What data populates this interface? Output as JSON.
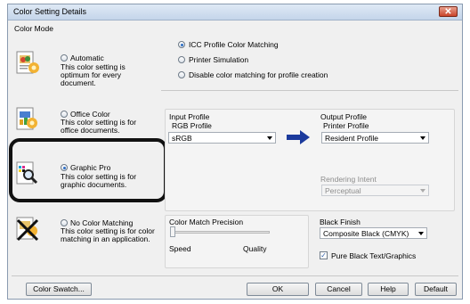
{
  "window": {
    "title": "Color Setting Details",
    "close_glyph": "✕"
  },
  "color_mode": {
    "label": "Color Mode",
    "modes": [
      {
        "label": "Automatic",
        "desc": "This color setting is optimum for every document.",
        "selected": false,
        "icon": "automatic-color-icon"
      },
      {
        "label": "Office Color",
        "desc": "This color setting is for office documents.",
        "selected": false,
        "icon": "office-color-icon"
      },
      {
        "label": "Graphic Pro",
        "desc": "This color setting is for graphic documents.",
        "selected": true,
        "icon": "graphic-pro-icon"
      },
      {
        "label": "No Color Matching",
        "desc": "This color setting is for color matching in an application.",
        "selected": false,
        "icon": "no-color-matching-icon"
      }
    ]
  },
  "matching_options": [
    {
      "label": "ICC Profile Color Matching",
      "selected": true
    },
    {
      "label": "Printer Simulation",
      "selected": false
    },
    {
      "label": "Disable color matching for profile creation",
      "selected": false
    }
  ],
  "input_profile": {
    "label": "Input Profile",
    "sub_label": "RGB Profile",
    "value": "sRGB"
  },
  "output_profile": {
    "label": "Output Profile",
    "sub_label": "Printer Profile",
    "value": "Resident Profile"
  },
  "rendering_intent": {
    "label": "Rendering Intent",
    "value": "Perceptual",
    "enabled": false
  },
  "precision": {
    "label": "Color Match Precision",
    "min_label": "Speed",
    "max_label": "Quality",
    "value": 0.0
  },
  "black_finish": {
    "label": "Black Finish",
    "value": "Composite Black (CMYK)"
  },
  "pure_black": {
    "label": "Pure Black Text/Graphics",
    "checked": true,
    "check_glyph": "✓"
  },
  "buttons": {
    "color_swatch": "Color Swatch...",
    "ok": "OK",
    "cancel": "Cancel",
    "help": "Help",
    "default": "Default"
  },
  "colors": {
    "accent_arrow": "#1b3a9c",
    "highlight_frame": "#111111"
  }
}
